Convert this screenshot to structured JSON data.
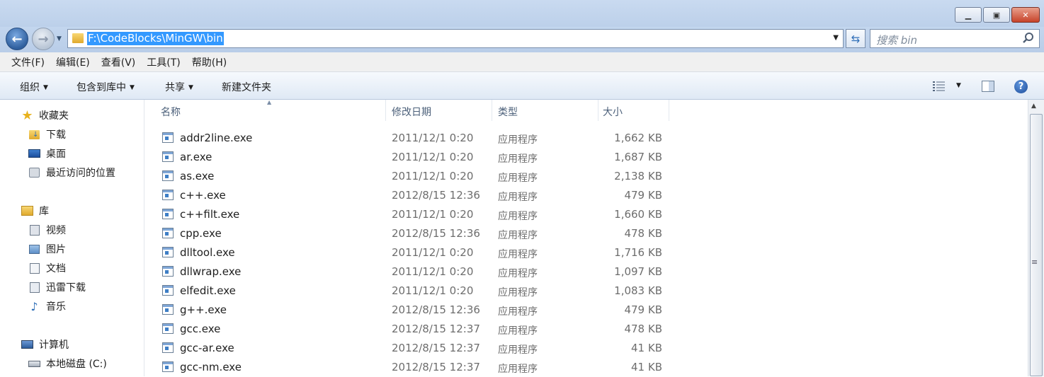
{
  "window": {
    "minimize_glyph": "▁",
    "maximize_glyph": "▣",
    "close_glyph": "✕"
  },
  "address": {
    "path": "F:\\CodeBlocks\\MinGW\\bin",
    "search_placeholder": "搜索 bin"
  },
  "menu": [
    "文件(F)",
    "编辑(E)",
    "查看(V)",
    "工具(T)",
    "帮助(H)"
  ],
  "toolbar": {
    "organize": "组织",
    "include_library": "包含到库中",
    "share": "共享",
    "new_folder": "新建文件夹",
    "help_glyph": "?"
  },
  "navpane": {
    "favorites": "收藏夹",
    "downloads": "下载",
    "desktop": "桌面",
    "recent": "最近访问的位置",
    "libraries": "库",
    "videos": "视频",
    "pictures": "图片",
    "documents": "文档",
    "thunder": "迅雷下载",
    "music": "音乐",
    "computer": "计算机",
    "local_disk": "本地磁盘 (C:)"
  },
  "columns": {
    "name": "名称",
    "modified": "修改日期",
    "type": "类型",
    "size": "大小"
  },
  "files": [
    {
      "name": "addr2line.exe",
      "date": "2011/12/1 0:20",
      "type": "应用程序",
      "size": "1,662 KB"
    },
    {
      "name": "ar.exe",
      "date": "2011/12/1 0:20",
      "type": "应用程序",
      "size": "1,687 KB"
    },
    {
      "name": "as.exe",
      "date": "2011/12/1 0:20",
      "type": "应用程序",
      "size": "2,138 KB"
    },
    {
      "name": "c++.exe",
      "date": "2012/8/15 12:36",
      "type": "应用程序",
      "size": "479 KB"
    },
    {
      "name": "c++filt.exe",
      "date": "2011/12/1 0:20",
      "type": "应用程序",
      "size": "1,660 KB"
    },
    {
      "name": "cpp.exe",
      "date": "2012/8/15 12:36",
      "type": "应用程序",
      "size": "478 KB"
    },
    {
      "name": "dlltool.exe",
      "date": "2011/12/1 0:20",
      "type": "应用程序",
      "size": "1,716 KB"
    },
    {
      "name": "dllwrap.exe",
      "date": "2011/12/1 0:20",
      "type": "应用程序",
      "size": "1,097 KB"
    },
    {
      "name": "elfedit.exe",
      "date": "2011/12/1 0:20",
      "type": "应用程序",
      "size": "1,083 KB"
    },
    {
      "name": "g++.exe",
      "date": "2012/8/15 12:36",
      "type": "应用程序",
      "size": "479 KB"
    },
    {
      "name": "gcc.exe",
      "date": "2012/8/15 12:37",
      "type": "应用程序",
      "size": "478 KB"
    },
    {
      "name": "gcc-ar.exe",
      "date": "2012/8/15 12:37",
      "type": "应用程序",
      "size": "41 KB"
    },
    {
      "name": "gcc-nm.exe",
      "date": "2012/8/15 12:37",
      "type": "应用程序",
      "size": "41 KB"
    }
  ]
}
